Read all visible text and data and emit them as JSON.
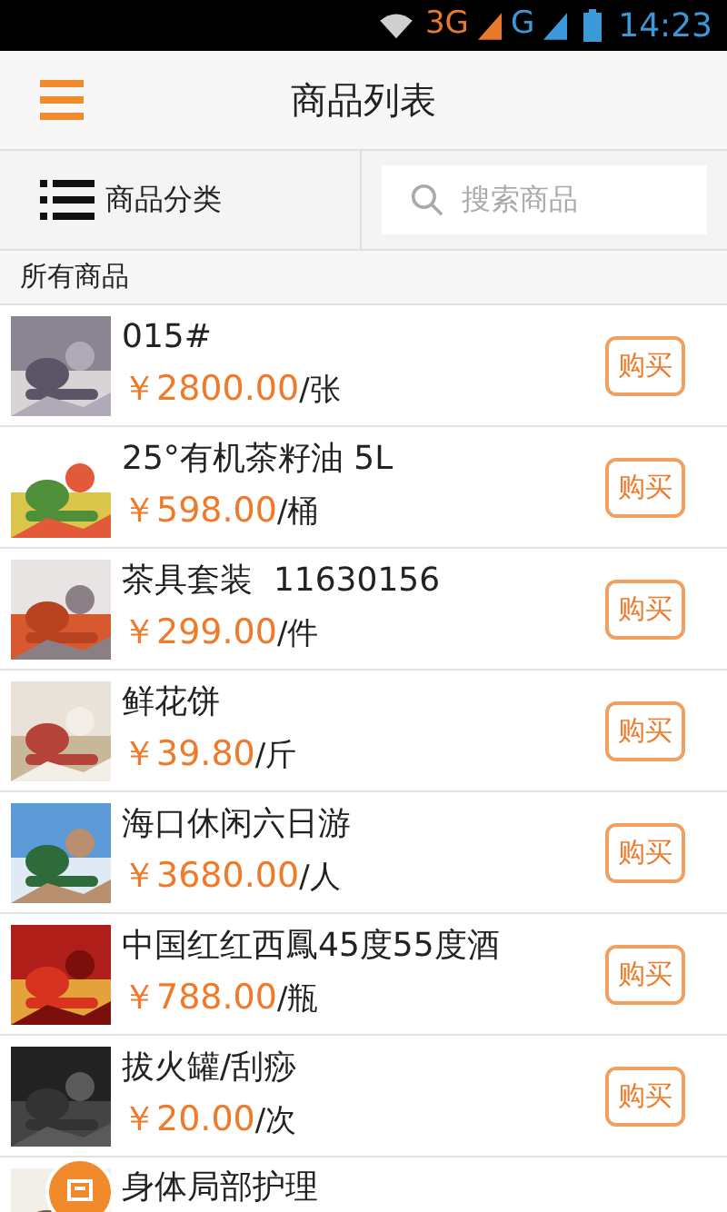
{
  "status_bar": {
    "network_1": "3G",
    "network_2": "G",
    "time": "14:23"
  },
  "header": {
    "title": "商品列表"
  },
  "filter": {
    "category_label": "商品分类",
    "search_placeholder": "搜索商品"
  },
  "section_title": "所有商品",
  "products": [
    {
      "kind": "full",
      "name": "015#",
      "price": "￥2800.00",
      "unit": "/张",
      "buy": "购买"
    },
    {
      "kind": "full",
      "name": "25°有机茶籽油 5L",
      "price": "￥598.00",
      "unit": "/桶",
      "buy": "购买"
    },
    {
      "kind": "full",
      "name": "茶具套装  11630156",
      "price": "￥299.00",
      "unit": "/件",
      "buy": "购买"
    },
    {
      "kind": "full",
      "name": "鲜花饼",
      "price": "￥39.80",
      "unit": "/斤",
      "buy": "购买"
    },
    {
      "kind": "full",
      "name": "海口休闲六日游",
      "price": "￥3680.00",
      "unit": "/人",
      "buy": "购买"
    },
    {
      "kind": "full",
      "name": "中国红红西鳳45度55度酒",
      "price": "￥788.00",
      "unit": "/瓶",
      "buy": "购买"
    },
    {
      "kind": "full",
      "name": "拔火罐/刮痧",
      "price": "￥20.00",
      "unit": "/次",
      "buy": "购买"
    },
    {
      "kind": "partial",
      "name": "身体局部护理"
    }
  ]
}
